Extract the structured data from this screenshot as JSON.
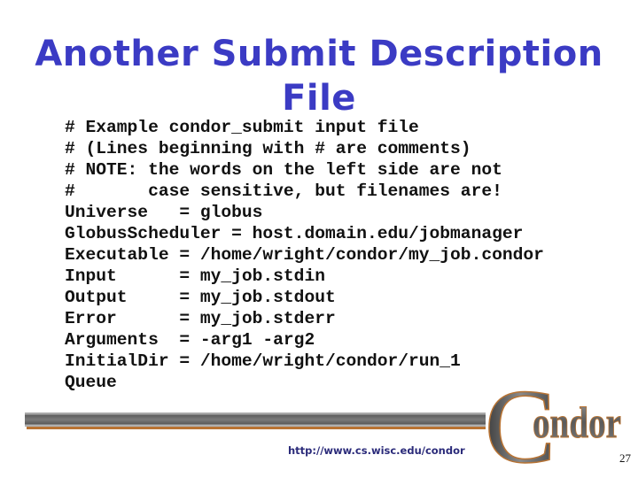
{
  "slide": {
    "title_line1": "Another Submit Description",
    "title_line2": "File",
    "code_lines": [
      "# Example condor_submit input file",
      "# (Lines beginning with # are comments)",
      "# NOTE: the words on the left side are not",
      "#       case sensitive, but filenames are!",
      "Universe   = globus",
      "GlobusScheduler = host.domain.edu/jobmanager",
      "Executable = /home/wright/condor/my_job.condor",
      "Input      = my_job.stdin",
      "Output     = my_job.stdout",
      "Error      = my_job.stderr",
      "Arguments  = -arg1 -arg2",
      "InitialDir = /home/wright/condor/run_1",
      "Queue"
    ],
    "footer_url": "http://www.cs.wisc.edu/condor",
    "logo_text": "Condor",
    "logo_initial": "C",
    "logo_rest": "ondor",
    "page_number": "27"
  },
  "colors": {
    "title": "#3b3bc4",
    "code": "#111111",
    "url": "#2b2b7a",
    "bar_gray": "#6e6e6e",
    "bar_accent": "#b87333"
  }
}
